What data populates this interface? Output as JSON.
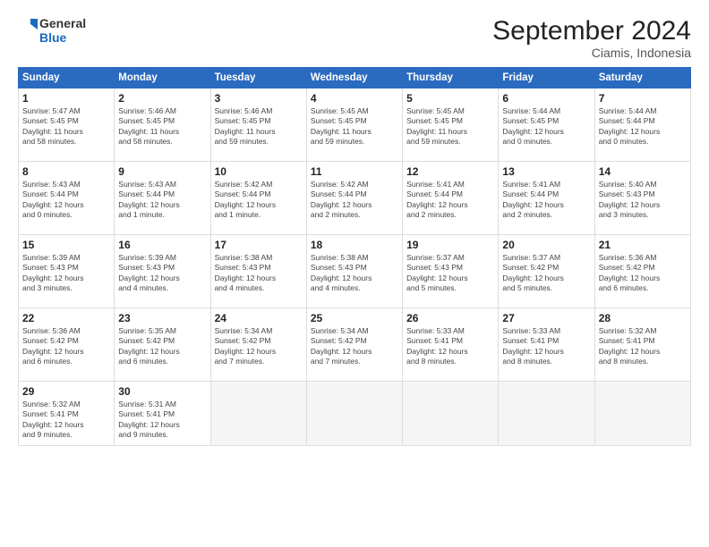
{
  "header": {
    "logo_line1": "General",
    "logo_line2": "Blue",
    "month": "September 2024",
    "location": "Ciamis, Indonesia"
  },
  "days_of_week": [
    "Sunday",
    "Monday",
    "Tuesday",
    "Wednesday",
    "Thursday",
    "Friday",
    "Saturday"
  ],
  "weeks": [
    [
      {
        "day": "1",
        "info": "Sunrise: 5:47 AM\nSunset: 5:45 PM\nDaylight: 11 hours\nand 58 minutes."
      },
      {
        "day": "2",
        "info": "Sunrise: 5:46 AM\nSunset: 5:45 PM\nDaylight: 11 hours\nand 58 minutes."
      },
      {
        "day": "3",
        "info": "Sunrise: 5:46 AM\nSunset: 5:45 PM\nDaylight: 11 hours\nand 59 minutes."
      },
      {
        "day": "4",
        "info": "Sunrise: 5:45 AM\nSunset: 5:45 PM\nDaylight: 11 hours\nand 59 minutes."
      },
      {
        "day": "5",
        "info": "Sunrise: 5:45 AM\nSunset: 5:45 PM\nDaylight: 11 hours\nand 59 minutes."
      },
      {
        "day": "6",
        "info": "Sunrise: 5:44 AM\nSunset: 5:45 PM\nDaylight: 12 hours\nand 0 minutes."
      },
      {
        "day": "7",
        "info": "Sunrise: 5:44 AM\nSunset: 5:44 PM\nDaylight: 12 hours\nand 0 minutes."
      }
    ],
    [
      {
        "day": "8",
        "info": "Sunrise: 5:43 AM\nSunset: 5:44 PM\nDaylight: 12 hours\nand 0 minutes."
      },
      {
        "day": "9",
        "info": "Sunrise: 5:43 AM\nSunset: 5:44 PM\nDaylight: 12 hours\nand 1 minute."
      },
      {
        "day": "10",
        "info": "Sunrise: 5:42 AM\nSunset: 5:44 PM\nDaylight: 12 hours\nand 1 minute."
      },
      {
        "day": "11",
        "info": "Sunrise: 5:42 AM\nSunset: 5:44 PM\nDaylight: 12 hours\nand 2 minutes."
      },
      {
        "day": "12",
        "info": "Sunrise: 5:41 AM\nSunset: 5:44 PM\nDaylight: 12 hours\nand 2 minutes."
      },
      {
        "day": "13",
        "info": "Sunrise: 5:41 AM\nSunset: 5:44 PM\nDaylight: 12 hours\nand 2 minutes."
      },
      {
        "day": "14",
        "info": "Sunrise: 5:40 AM\nSunset: 5:43 PM\nDaylight: 12 hours\nand 3 minutes."
      }
    ],
    [
      {
        "day": "15",
        "info": "Sunrise: 5:39 AM\nSunset: 5:43 PM\nDaylight: 12 hours\nand 3 minutes."
      },
      {
        "day": "16",
        "info": "Sunrise: 5:39 AM\nSunset: 5:43 PM\nDaylight: 12 hours\nand 4 minutes."
      },
      {
        "day": "17",
        "info": "Sunrise: 5:38 AM\nSunset: 5:43 PM\nDaylight: 12 hours\nand 4 minutes."
      },
      {
        "day": "18",
        "info": "Sunrise: 5:38 AM\nSunset: 5:43 PM\nDaylight: 12 hours\nand 4 minutes."
      },
      {
        "day": "19",
        "info": "Sunrise: 5:37 AM\nSunset: 5:43 PM\nDaylight: 12 hours\nand 5 minutes."
      },
      {
        "day": "20",
        "info": "Sunrise: 5:37 AM\nSunset: 5:42 PM\nDaylight: 12 hours\nand 5 minutes."
      },
      {
        "day": "21",
        "info": "Sunrise: 5:36 AM\nSunset: 5:42 PM\nDaylight: 12 hours\nand 6 minutes."
      }
    ],
    [
      {
        "day": "22",
        "info": "Sunrise: 5:36 AM\nSunset: 5:42 PM\nDaylight: 12 hours\nand 6 minutes."
      },
      {
        "day": "23",
        "info": "Sunrise: 5:35 AM\nSunset: 5:42 PM\nDaylight: 12 hours\nand 6 minutes."
      },
      {
        "day": "24",
        "info": "Sunrise: 5:34 AM\nSunset: 5:42 PM\nDaylight: 12 hours\nand 7 minutes."
      },
      {
        "day": "25",
        "info": "Sunrise: 5:34 AM\nSunset: 5:42 PM\nDaylight: 12 hours\nand 7 minutes."
      },
      {
        "day": "26",
        "info": "Sunrise: 5:33 AM\nSunset: 5:41 PM\nDaylight: 12 hours\nand 8 minutes."
      },
      {
        "day": "27",
        "info": "Sunrise: 5:33 AM\nSunset: 5:41 PM\nDaylight: 12 hours\nand 8 minutes."
      },
      {
        "day": "28",
        "info": "Sunrise: 5:32 AM\nSunset: 5:41 PM\nDaylight: 12 hours\nand 8 minutes."
      }
    ],
    [
      {
        "day": "29",
        "info": "Sunrise: 5:32 AM\nSunset: 5:41 PM\nDaylight: 12 hours\nand 9 minutes."
      },
      {
        "day": "30",
        "info": "Sunrise: 5:31 AM\nSunset: 5:41 PM\nDaylight: 12 hours\nand 9 minutes."
      },
      {
        "day": "",
        "info": ""
      },
      {
        "day": "",
        "info": ""
      },
      {
        "day": "",
        "info": ""
      },
      {
        "day": "",
        "info": ""
      },
      {
        "day": "",
        "info": ""
      }
    ]
  ]
}
